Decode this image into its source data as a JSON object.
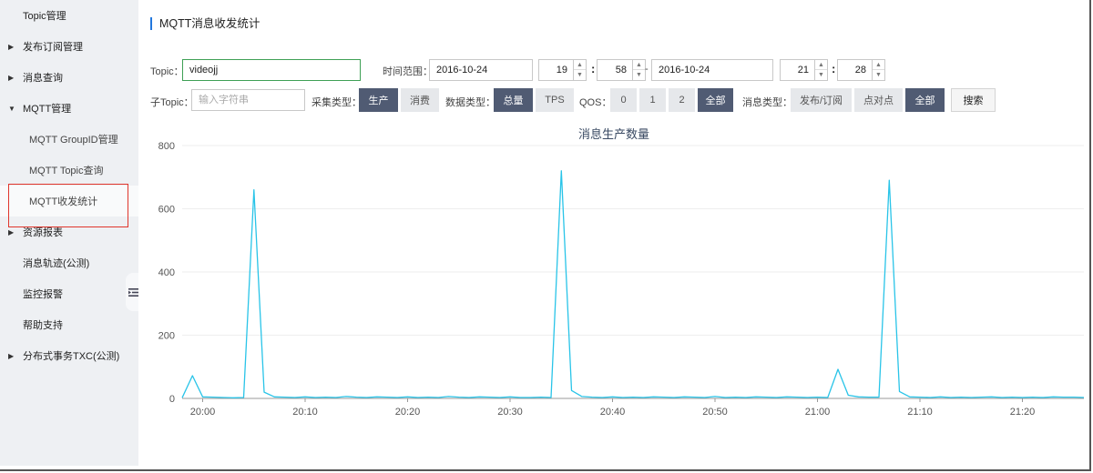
{
  "sidebar": {
    "items": [
      {
        "label": "Topic管理",
        "arrow": ""
      },
      {
        "label": "发布订阅管理",
        "arrow": "▶"
      },
      {
        "label": "消息查询",
        "arrow": "▶"
      },
      {
        "label": "MQTT管理",
        "arrow": "▼"
      },
      {
        "label": "MQTT GroupID管理",
        "arrow": ""
      },
      {
        "label": "MQTT Topic查询",
        "arrow": ""
      },
      {
        "label": "MQTT收发统计",
        "arrow": ""
      },
      {
        "label": "资源报表",
        "arrow": "▶"
      },
      {
        "label": "消息轨迹(公测)",
        "arrow": ""
      },
      {
        "label": "监控报警",
        "arrow": ""
      },
      {
        "label": "帮助支持",
        "arrow": ""
      },
      {
        "label": "分布式事务TXC(公测)",
        "arrow": "▶"
      }
    ],
    "collapse_icon": "menu-collapse-icon"
  },
  "page": {
    "title": "MQTT消息收发统计"
  },
  "filters": {
    "topic_label": "Topic：",
    "topic_value": "videojj",
    "time_range_label": "时间范围：",
    "start_date": "2016-10-24",
    "start_hour": "19",
    "start_minute": "58",
    "range_separator": "-",
    "end_date": "2016-10-24",
    "end_hour": "21",
    "end_minute": "28",
    "colon": ":",
    "sub_topic_label": "子Topic：",
    "sub_topic_placeholder": "输入字符串",
    "collect_type_label": "采集类型：",
    "collect_produce": "生产",
    "collect_consume": "消费",
    "data_type_label": "数据类型：",
    "data_total": "总量",
    "data_tps": "TPS",
    "qos_label": "QOS：",
    "qos_0": "0",
    "qos_1": "1",
    "qos_2": "2",
    "qos_all": "全部",
    "msg_type_label": "消息类型：",
    "msg_pubsub": "发布/订阅",
    "msg_p2p": "点对点",
    "msg_all": "全部",
    "search": "搜索"
  },
  "chart_data": {
    "type": "line",
    "title": "消息生产数量",
    "xlabel": "",
    "ylabel": "",
    "ylim": [
      0,
      800
    ],
    "yticks": [
      0,
      200,
      400,
      600,
      800
    ],
    "xticks": [
      "20:00",
      "20:10",
      "20:20",
      "20:30",
      "20:40",
      "20:50",
      "21:00",
      "21:10",
      "21:20"
    ],
    "x_range_minutes": [
      1198,
      1286
    ],
    "grid": true,
    "line_color": "#29c4e8",
    "series": [
      {
        "x": [
          1198,
          1199,
          1200,
          1201,
          1202,
          1203,
          1204,
          1205,
          1206,
          1207,
          1208,
          1209,
          1210,
          1211,
          1212,
          1213,
          1214,
          1215,
          1216,
          1217,
          1218,
          1219,
          1220,
          1221,
          1222,
          1223,
          1224,
          1225,
          1226,
          1227,
          1228,
          1229,
          1230,
          1231,
          1232,
          1233,
          1234,
          1235,
          1236,
          1237,
          1238,
          1239,
          1240,
          1241,
          1242,
          1243,
          1244,
          1245,
          1246,
          1247,
          1248,
          1249,
          1250,
          1251,
          1252,
          1253,
          1254,
          1255,
          1256,
          1257,
          1258,
          1259,
          1260,
          1261,
          1262,
          1263,
          1264,
          1265,
          1266,
          1267,
          1268,
          1269,
          1270,
          1271,
          1272,
          1273,
          1274,
          1275,
          1276,
          1277,
          1278,
          1279,
          1280,
          1281,
          1282,
          1283,
          1284,
          1285,
          1286
        ],
        "values": [
          2,
          72,
          5,
          4,
          3,
          2,
          3,
          660,
          20,
          5,
          4,
          3,
          5,
          3,
          4,
          3,
          6,
          4,
          3,
          5,
          4,
          3,
          5,
          3,
          4,
          3,
          6,
          4,
          3,
          5,
          4,
          3,
          5,
          3,
          3,
          4,
          3,
          720,
          25,
          6,
          4,
          3,
          5,
          3,
          4,
          3,
          5,
          4,
          3,
          5,
          4,
          3,
          6,
          3,
          4,
          3,
          5,
          4,
          3,
          5,
          4,
          3,
          4,
          3,
          92,
          10,
          5,
          4,
          4,
          690,
          22,
          5,
          4,
          3,
          5,
          3,
          4,
          3,
          4,
          5,
          3,
          4,
          3,
          4,
          3,
          5,
          4,
          4,
          3
        ]
      }
    ]
  }
}
